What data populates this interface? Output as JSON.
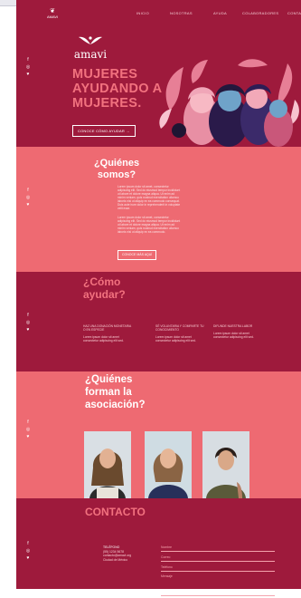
{
  "nav": {
    "logo_text": "AMAVI",
    "links": [
      "INICIO",
      "NOSOTRAS",
      "AYUDA",
      "COLABORADORES",
      "CONTACTO"
    ]
  },
  "social": [
    "f",
    "◎",
    "♥"
  ],
  "hero": {
    "brand": "amavi",
    "title_line1": "MUJERES",
    "title_line2": "AYUDANDO A",
    "title_line3": "MUJERES.",
    "cta": "CONOCE CÓMO AYUDAR →"
  },
  "about": {
    "title": "¿Quiénes somos?",
    "para1": "Lorem ipsum dolor sit amet, consectetur adipiscing elit. Sed do eiusmod tempor incididunt ut labore et dolore magna aliqua. Ut enim ad minim veniam, quis nostrud exercitation ullamco laboris nisi ut aliquip ex ea commodo consequat. Duis aute irure dolor in reprehenderit in voluptate velit esse.",
    "para2": "Lorem ipsum dolor sit amet, consectetur adipiscing elit. Sed do eiusmod tempor incididunt ut labore et dolore magna aliqua. Ut enim ad minim veniam, quis nostrud exercitation ullamco laboris nisi ut aliquip ex ea commodo.",
    "button": "CONOCE MÁS AQUÍ"
  },
  "help": {
    "title": "¿Cómo ayudar?",
    "columns": [
      {
        "heading": "HAZ UNA DONACIÓN MONETARIA O EN ESPECIE",
        "text": "Lorem ipsum dolor sit amet consectetur adipiscing elit sed."
      },
      {
        "heading": "SÉ VOLUNTARIA Y COMPARTE TU CONOCIMIENTO",
        "text": "Lorem ipsum dolor sit amet consectetur adipiscing elit sed."
      },
      {
        "heading": "DIFUNDE NUESTRA LABOR",
        "text": "Lorem ipsum dolor sit amet consectetur adipiscing elit sed."
      }
    ]
  },
  "team": {
    "title_line1": "¿Quiénes",
    "title_line2": "forman la",
    "title_line3": "asociación?"
  },
  "contact": {
    "title": "CONTACTO",
    "info_label": "TELÉFONO",
    "info_lines": [
      "(55) 1234 5678",
      "contacto@amavi.org",
      "Ciudad de México"
    ],
    "form_fields": [
      "Nombre",
      "Correo",
      "Teléfono",
      "Mensaje"
    ]
  },
  "colors": {
    "primary": "#9e1a3c",
    "accent": "#ee6a72",
    "title_pink": "#f2727f"
  }
}
